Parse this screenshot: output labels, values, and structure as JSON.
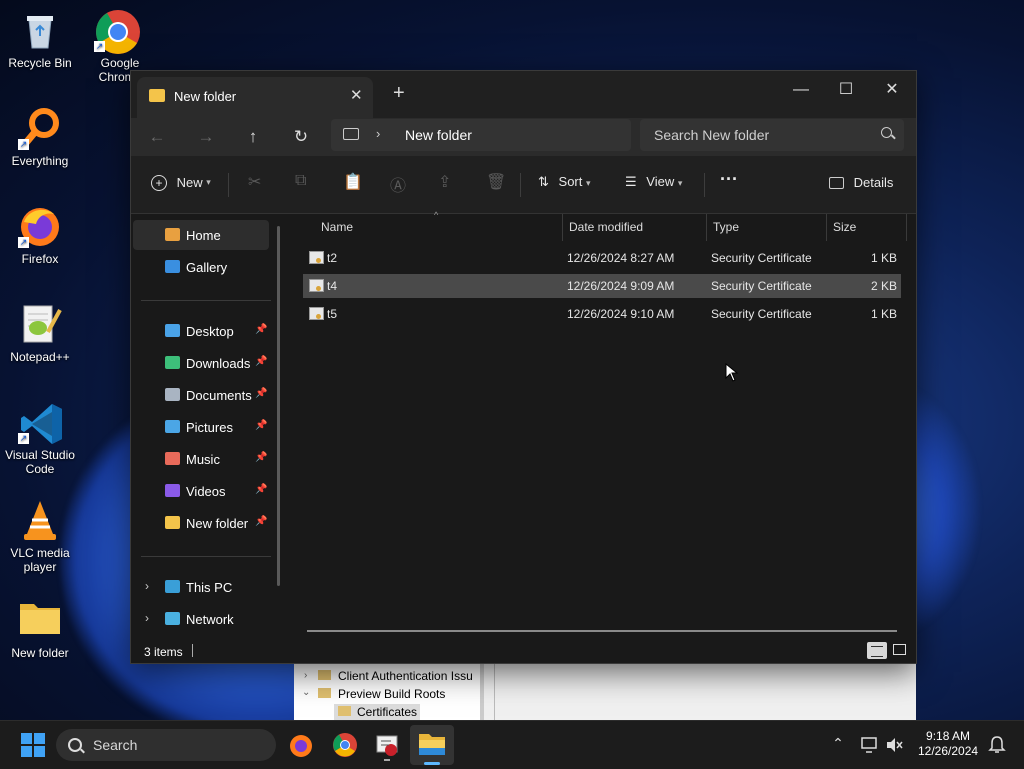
{
  "desktop": {
    "icons": [
      {
        "label": "Recycle Bin"
      },
      {
        "label": "Google Chrome"
      },
      {
        "label": "Everything"
      },
      {
        "label": "Firefox"
      },
      {
        "label": "Notepad++"
      },
      {
        "label": "Visual Studio Code"
      },
      {
        "label": "VLC media player"
      },
      {
        "label": "New folder"
      }
    ]
  },
  "window": {
    "tab_title": "New folder",
    "close_tab": "✕",
    "new_tab": "+",
    "minimize": "—",
    "maximize": "☐",
    "close": "✕"
  },
  "nav": {
    "back": "←",
    "forward": "→",
    "up": "↑",
    "refresh": "↻",
    "breadcrumb_sep": "›",
    "breadcrumb": "New folder",
    "search_placeholder": "Search New folder"
  },
  "commandbar": {
    "new_label": "New",
    "sort_label": "Sort",
    "view_label": "View",
    "more": "···",
    "details_label": "Details"
  },
  "sidebar": {
    "home": "Home",
    "gallery": "Gallery",
    "quick_access": [
      {
        "label": "Desktop",
        "color": "#4aa3e8"
      },
      {
        "label": "Downloads",
        "color": "#3dbf7a"
      },
      {
        "label": "Documents",
        "color": "#a9b4c2"
      },
      {
        "label": "Pictures",
        "color": "#4ba6e6"
      },
      {
        "label": "Music",
        "color": "#e86a5a"
      },
      {
        "label": "Videos",
        "color": "#8a5ae8"
      },
      {
        "label": "New folder",
        "color": "#f4c44a"
      }
    ],
    "this_pc": "This PC",
    "network": "Network"
  },
  "filelist": {
    "columns": [
      "Name",
      "Date modified",
      "Type",
      "Size"
    ],
    "rows": [
      {
        "name": "t2",
        "date": "12/26/2024 8:27 AM",
        "type": "Security Certificate",
        "size": "1 KB"
      },
      {
        "name": "t4",
        "date": "12/26/2024 9:09 AM",
        "type": "Security Certificate",
        "size": "2 KB"
      },
      {
        "name": "t5",
        "date": "12/26/2024 9:10 AM",
        "type": "Security Certificate",
        "size": "1 KB"
      }
    ],
    "selected_row": 1
  },
  "status": {
    "items": "3 items"
  },
  "background_window": {
    "items": [
      "Client Authentication Issu",
      "Preview Build Roots",
      "Certificates"
    ]
  },
  "taskbar": {
    "search_placeholder": "Search",
    "time": "9:18 AM",
    "date": "12/26/2024"
  }
}
